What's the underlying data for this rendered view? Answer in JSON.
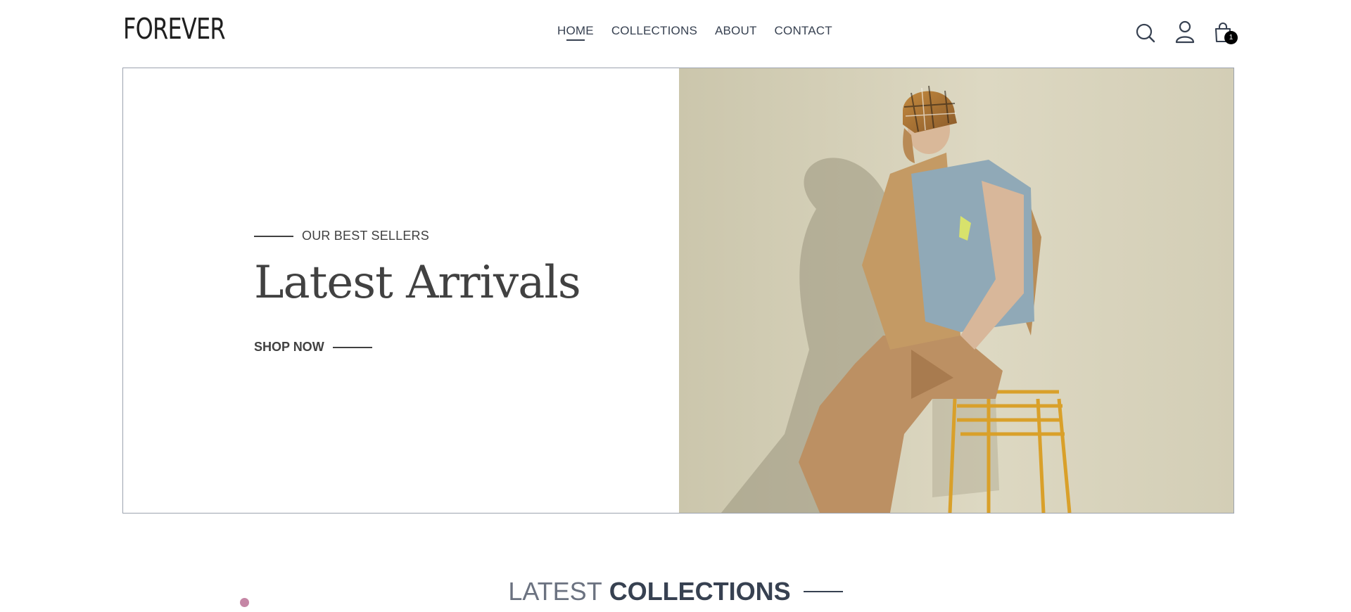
{
  "brand": {
    "name": "FOREVER",
    "dot_color": "#c586a5"
  },
  "nav": {
    "items": [
      {
        "label": "HOME",
        "active": true
      },
      {
        "label": "COLLECTIONS",
        "active": false
      },
      {
        "label": "ABOUT",
        "active": false
      },
      {
        "label": "CONTACT",
        "active": false
      }
    ]
  },
  "header_icons": {
    "search": "search-icon",
    "profile": "user-icon",
    "cart": "shopping-bag-icon",
    "cart_count": "1"
  },
  "hero": {
    "tagline": "OUR BEST SELLERS",
    "title": "Latest Arrivals",
    "cta_label": "SHOP NOW",
    "image": "model seated on orange wire stool wearing plaid cap, blue tee and tan trousers"
  },
  "section": {
    "title_light": "LATEST",
    "title_bold": "COLLECTIONS"
  },
  "colors": {
    "text_primary": "#374151",
    "text_hero": "#414141",
    "hero_backdrop": "#d8d2bd",
    "border": "#9ca3af"
  }
}
